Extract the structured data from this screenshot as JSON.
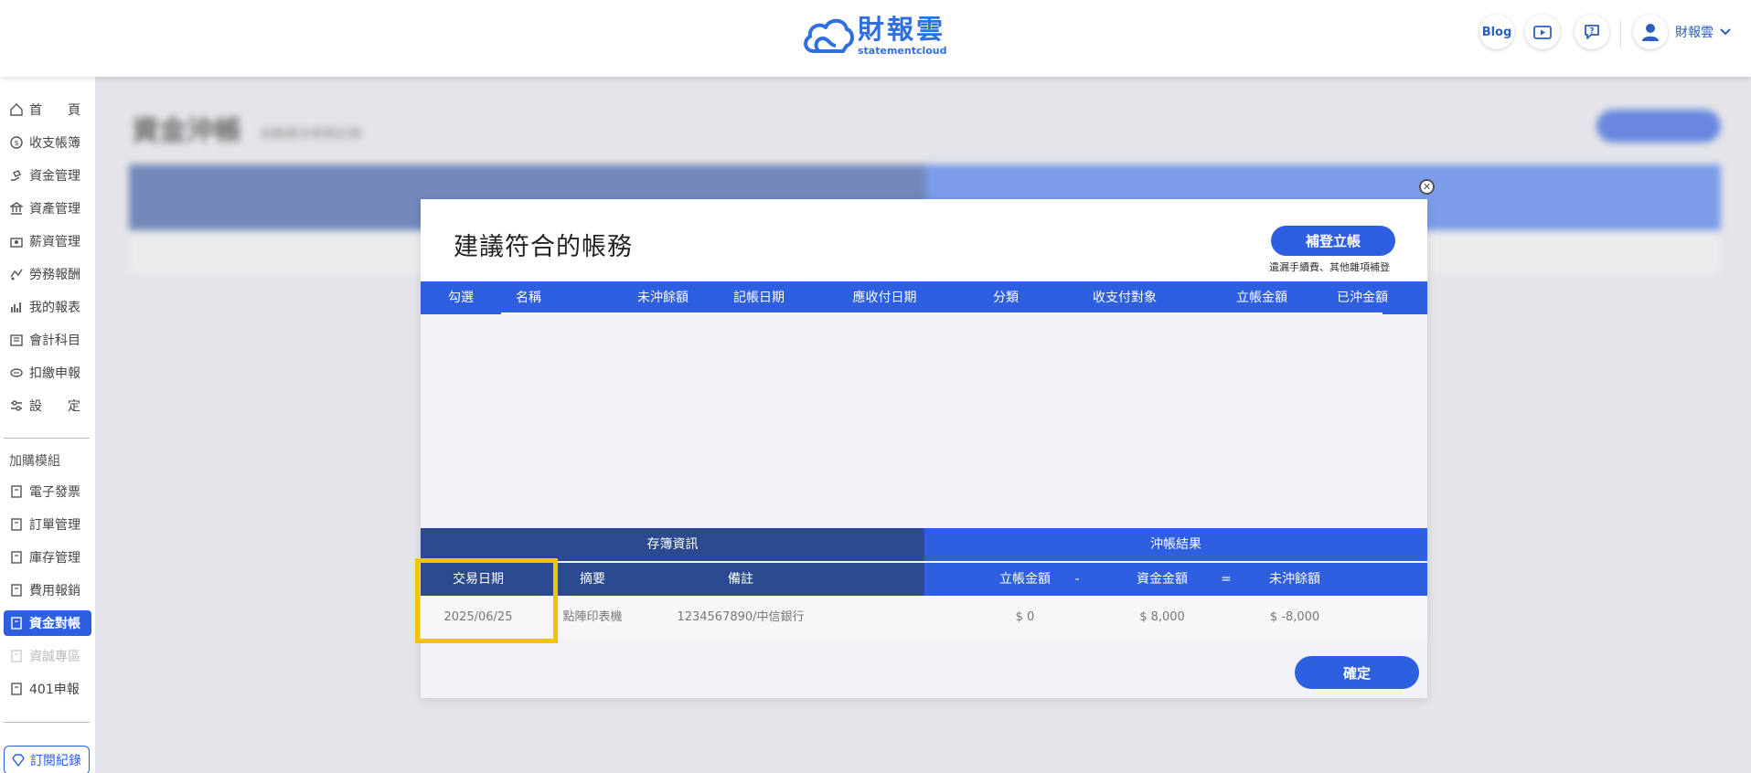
{
  "header": {
    "logo_cn": "財報雲",
    "logo_en": "statementcloud",
    "blog_label": "Blog",
    "user_name": "財報雲"
  },
  "sidebar": {
    "items": [
      {
        "label": "首　　頁",
        "icon": "home-icon"
      },
      {
        "label": "收支帳簿",
        "icon": "coin-icon"
      },
      {
        "label": "資金管理",
        "icon": "money-hand-icon"
      },
      {
        "label": "資產管理",
        "icon": "bank-icon"
      },
      {
        "label": "薪資管理",
        "icon": "payroll-icon"
      },
      {
        "label": "勞務報酬",
        "icon": "handshake-icon"
      },
      {
        "label": "我的報表",
        "icon": "bar-chart-icon"
      },
      {
        "label": "會計科目",
        "icon": "ledger-icon"
      },
      {
        "label": "扣繳申報",
        "icon": "tax-icon"
      },
      {
        "label": "設　　定",
        "icon": "settings-icon"
      }
    ],
    "section_label": "加購模組",
    "addons": [
      {
        "label": "電子發票"
      },
      {
        "label": "訂單管理"
      },
      {
        "label": "庫存管理"
      },
      {
        "label": "費用報銷"
      },
      {
        "label": "資金對帳"
      },
      {
        "label": "資誠專區"
      },
      {
        "label": "401申報"
      }
    ],
    "subscription_label": "訂閱紀錄"
  },
  "background": {
    "title": "資金沖帳",
    "subtitle": "自動媒合帳務記錄"
  },
  "modal": {
    "title": "建議符合的帳務",
    "add_button": "補登立帳",
    "add_note": "遺漏手續費、其他雜項補登",
    "columns": [
      "勾選",
      "名稱",
      "未沖餘額",
      "記帳日期",
      "應收付日期",
      "分類",
      "收支付對象",
      "立帳金額",
      "已沖金額"
    ],
    "group_left": "存簿資訊",
    "group_right": "沖帳結果",
    "sub_left": [
      "交易日期",
      "摘要",
      "備註"
    ],
    "sub_right": [
      "立帳金額",
      "-",
      "資金金額",
      "=",
      "未沖餘額"
    ],
    "row": {
      "date": "2025/06/25",
      "summary": "點陣印表機",
      "note": "1234567890/中信銀行",
      "booked": "$ 0",
      "fund": "$ 8,000",
      "balance": "$ -8,000"
    },
    "confirm_button": "確定"
  },
  "colors": {
    "primary": "#2d5fe0",
    "dark_blue": "#2c4a8f",
    "highlight": "#f3c300"
  }
}
